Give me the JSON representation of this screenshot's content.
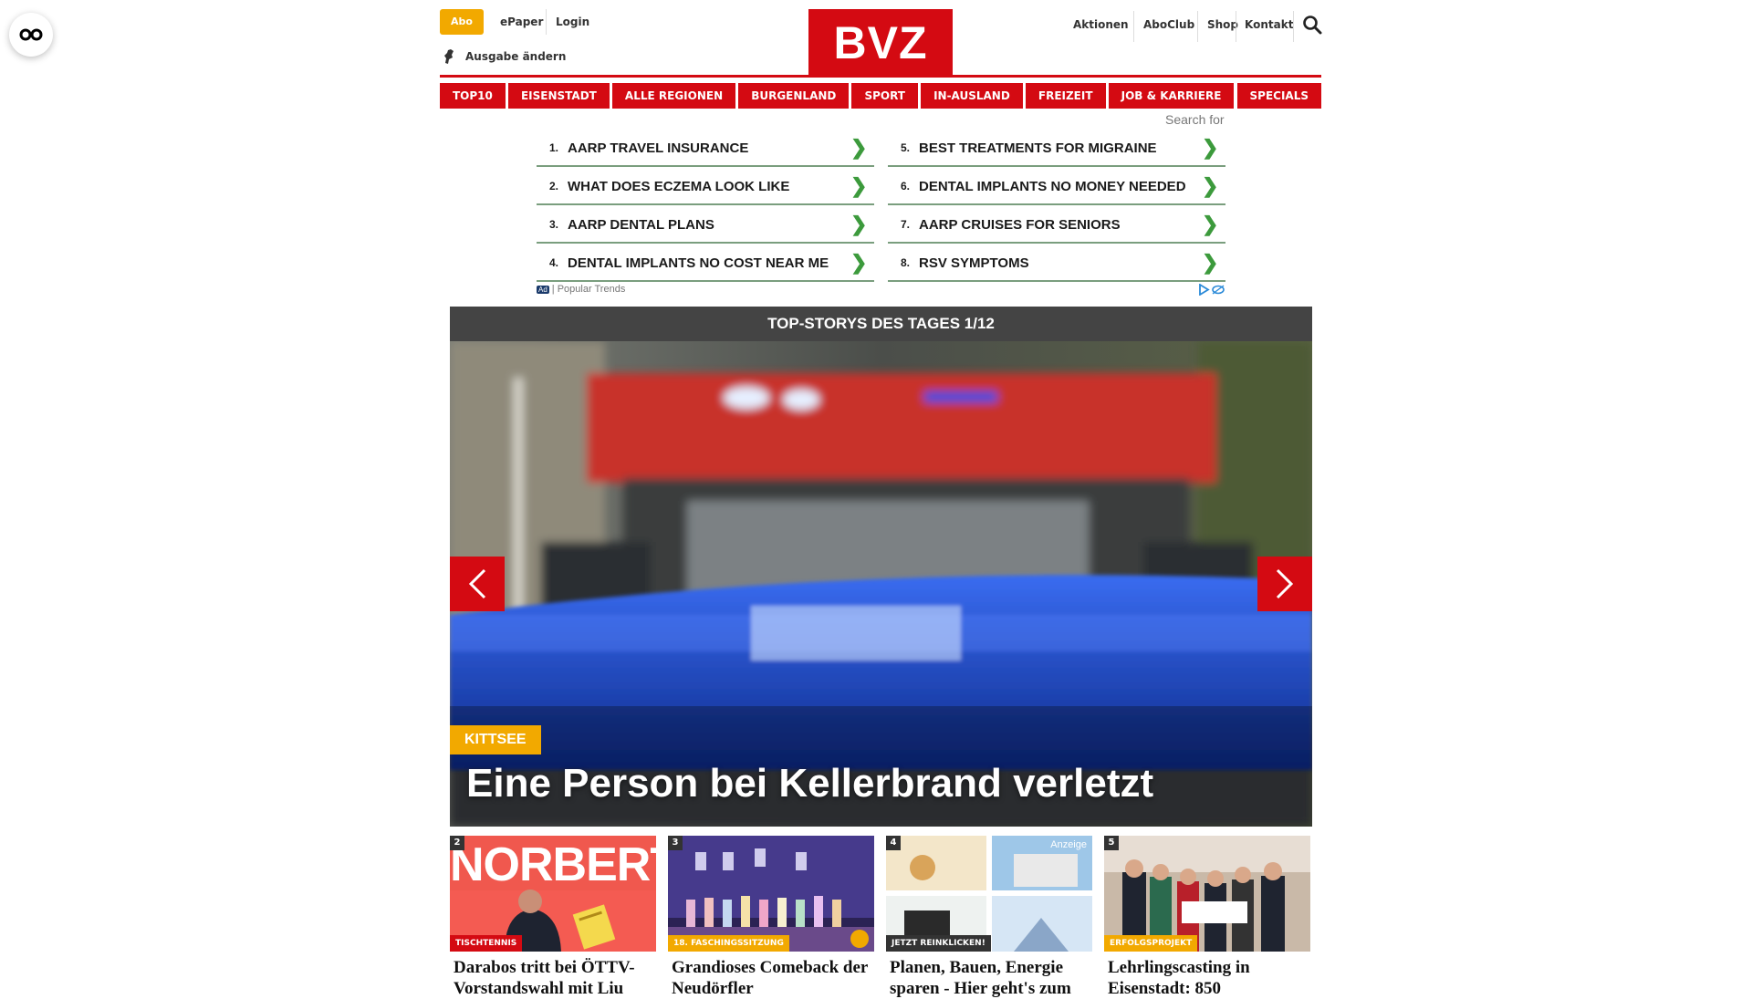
{
  "header": {
    "abo_label": "Abo",
    "epaper_label": "ePaper",
    "login_label": "Login",
    "edition_label": "Ausgabe ändern",
    "logo_text": "BVZ",
    "right_links": [
      "Aktionen",
      "AboClub",
      "Shop",
      "Kontakt"
    ]
  },
  "nav": {
    "items": [
      "TOP10",
      "EISENSTADT",
      "ALLE REGIONEN",
      "BURGENLAND",
      "SPORT",
      "IN-AUSLAND",
      "FREIZEIT",
      "JOB & KARRIERE",
      "SPECIALS"
    ]
  },
  "ad": {
    "search_label": "Search for",
    "left": [
      {
        "num": "1.",
        "text": "AARP TRAVEL INSURANCE"
      },
      {
        "num": "2.",
        "text": "WHAT DOES ECZEMA LOOK LIKE"
      },
      {
        "num": "3.",
        "text": "AARP DENTAL PLANS"
      },
      {
        "num": "4.",
        "text": "DENTAL IMPLANTS NO COST NEAR ME"
      }
    ],
    "right": [
      {
        "num": "5.",
        "text": "BEST TREATMENTS FOR MIGRAINE"
      },
      {
        "num": "6.",
        "text": "DENTAL IMPLANTS NO MONEY NEEDED"
      },
      {
        "num": "7.",
        "text": "AARP CRUISES FOR SENIORS"
      },
      {
        "num": "8.",
        "text": "RSV SYMPTOMS"
      }
    ],
    "badge": "Ad",
    "footer": "Popular Trends"
  },
  "topstories": {
    "bar_title": "TOP-STORYS DES TAGES 1/12",
    "hero_tag": "KITTSEE",
    "hero_title": "Eine Person bei Kellerbrand verletzt",
    "image_text": "NORBERT"
  },
  "cards": [
    {
      "num": "2",
      "category": "TISCHTENNIS",
      "title": "Darabos tritt bei ÖTTV-Vorstandswahl mit Liu"
    },
    {
      "num": "3",
      "category": "18. FASCHINGSSITZUNG",
      "title": "Grandioses Comeback der Neudörfler"
    },
    {
      "num": "4",
      "category": "JETZT REINKLICKEN!",
      "title": "Planen, Bauen, Energie sparen - Hier geht's zum",
      "sponsored": "Anzeige"
    },
    {
      "num": "5",
      "category": "ERFOLGSPROJEKT",
      "title": "Lehrlingscasting in Eisenstadt: 850"
    }
  ],
  "colors": {
    "brand_red": "#d40a12",
    "accent_orange": "#f2a900",
    "bar_gray": "#444444"
  }
}
